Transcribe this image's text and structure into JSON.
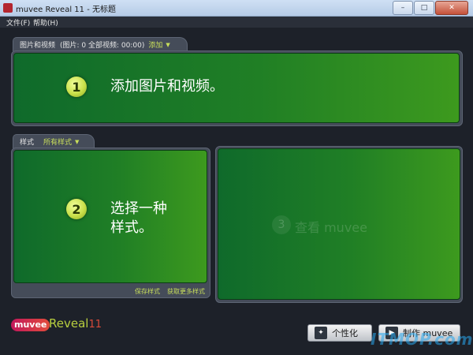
{
  "window": {
    "title": "muvee Reveal 11 - 无标题",
    "buttons": {
      "minimize": "–",
      "maximize": "□",
      "close": "✕"
    }
  },
  "menu": {
    "file": "文件(F)",
    "help": "帮助(H)"
  },
  "media_section": {
    "header_title": "图片和视频",
    "header_stats": "(图片: 0 全部视频: 00:00)",
    "add_label": "添加",
    "step_number": "1",
    "step_text": "添加图片和视频。"
  },
  "style_section": {
    "header_title": "样式",
    "filter_label": "所有样式",
    "step_number": "2",
    "step_text_line1": "选择一种",
    "step_text_line2": "样式。",
    "save_style": "保存样式",
    "more_styles": "获取更多样式"
  },
  "preview_section": {
    "step_number": "3",
    "step_text": "查看 muvee"
  },
  "logo": {
    "brand": "muvee",
    "product": "Reveal",
    "version": "11"
  },
  "buttons": {
    "personalize": "个性化",
    "make_muvee": "制作 muvee"
  },
  "watermark": "ITMOP.com",
  "colors": {
    "accent_yellow": "#c9df5a",
    "panel_green": "#207f25",
    "background": "#1d2129"
  }
}
